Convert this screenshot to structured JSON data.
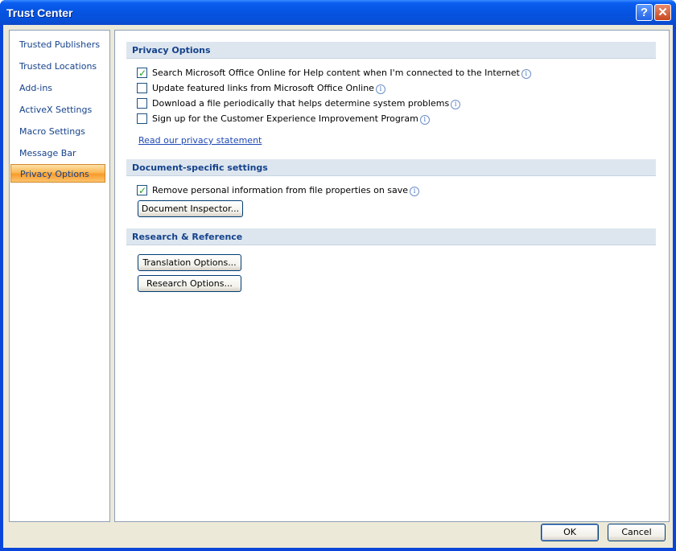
{
  "window": {
    "title": "Trust Center",
    "help_glyph": "?",
    "close_glyph": "✕"
  },
  "sidebar": {
    "items": [
      {
        "label": "Trusted Publishers"
      },
      {
        "label": "Trusted Locations"
      },
      {
        "label": "Add-ins"
      },
      {
        "label": "ActiveX Settings"
      },
      {
        "label": "Macro Settings"
      },
      {
        "label": "Message Bar"
      },
      {
        "label": "Privacy Options",
        "selected": true
      }
    ]
  },
  "privacy": {
    "header": "Privacy Options",
    "options": [
      {
        "label": "Search Microsoft Office Online for Help content when I'm connected to the Internet",
        "checked": true
      },
      {
        "label": "Update featured links from Microsoft Office Online",
        "checked": false
      },
      {
        "label": "Download a file periodically that helps determine system problems",
        "checked": false
      },
      {
        "label": "Sign up for the Customer Experience Improvement Program",
        "checked": false
      }
    ],
    "statement_link": "Read our privacy statement"
  },
  "document": {
    "header": "Document-specific settings",
    "remove_info_label": "Remove personal information from file properties on save",
    "remove_info_checked": true,
    "inspector_button": "Document Inspector..."
  },
  "research": {
    "header": "Research & Reference",
    "translation_button": "Translation Options...",
    "research_button": "Research Options..."
  },
  "footer": {
    "ok": "OK",
    "cancel": "Cancel"
  },
  "icons": {
    "info": "i",
    "check": "✓"
  },
  "colors": {
    "titlebar": "#0654e2",
    "accent_text": "#15428b",
    "selected_nav": "#fbb955",
    "section_bg": "#dde6ef"
  }
}
